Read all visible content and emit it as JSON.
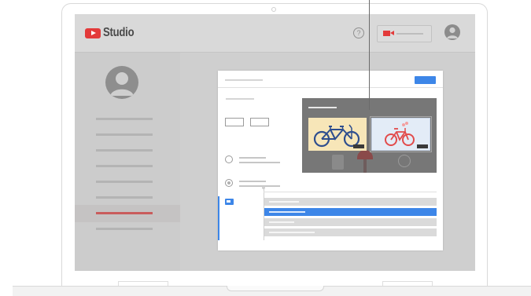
{
  "app": {
    "logo_icon": "youtube-play-icon",
    "name": "Studio",
    "brand_color": "#e33a3a"
  },
  "header": {
    "help_icon": "help-circle-icon",
    "help_glyph": "?",
    "create_icon": "video-camera-icon",
    "avatar_icon": "account-avatar-icon"
  },
  "colors": {
    "accent": "#3d86e8",
    "active_nav": "#c95c5c"
  }
}
